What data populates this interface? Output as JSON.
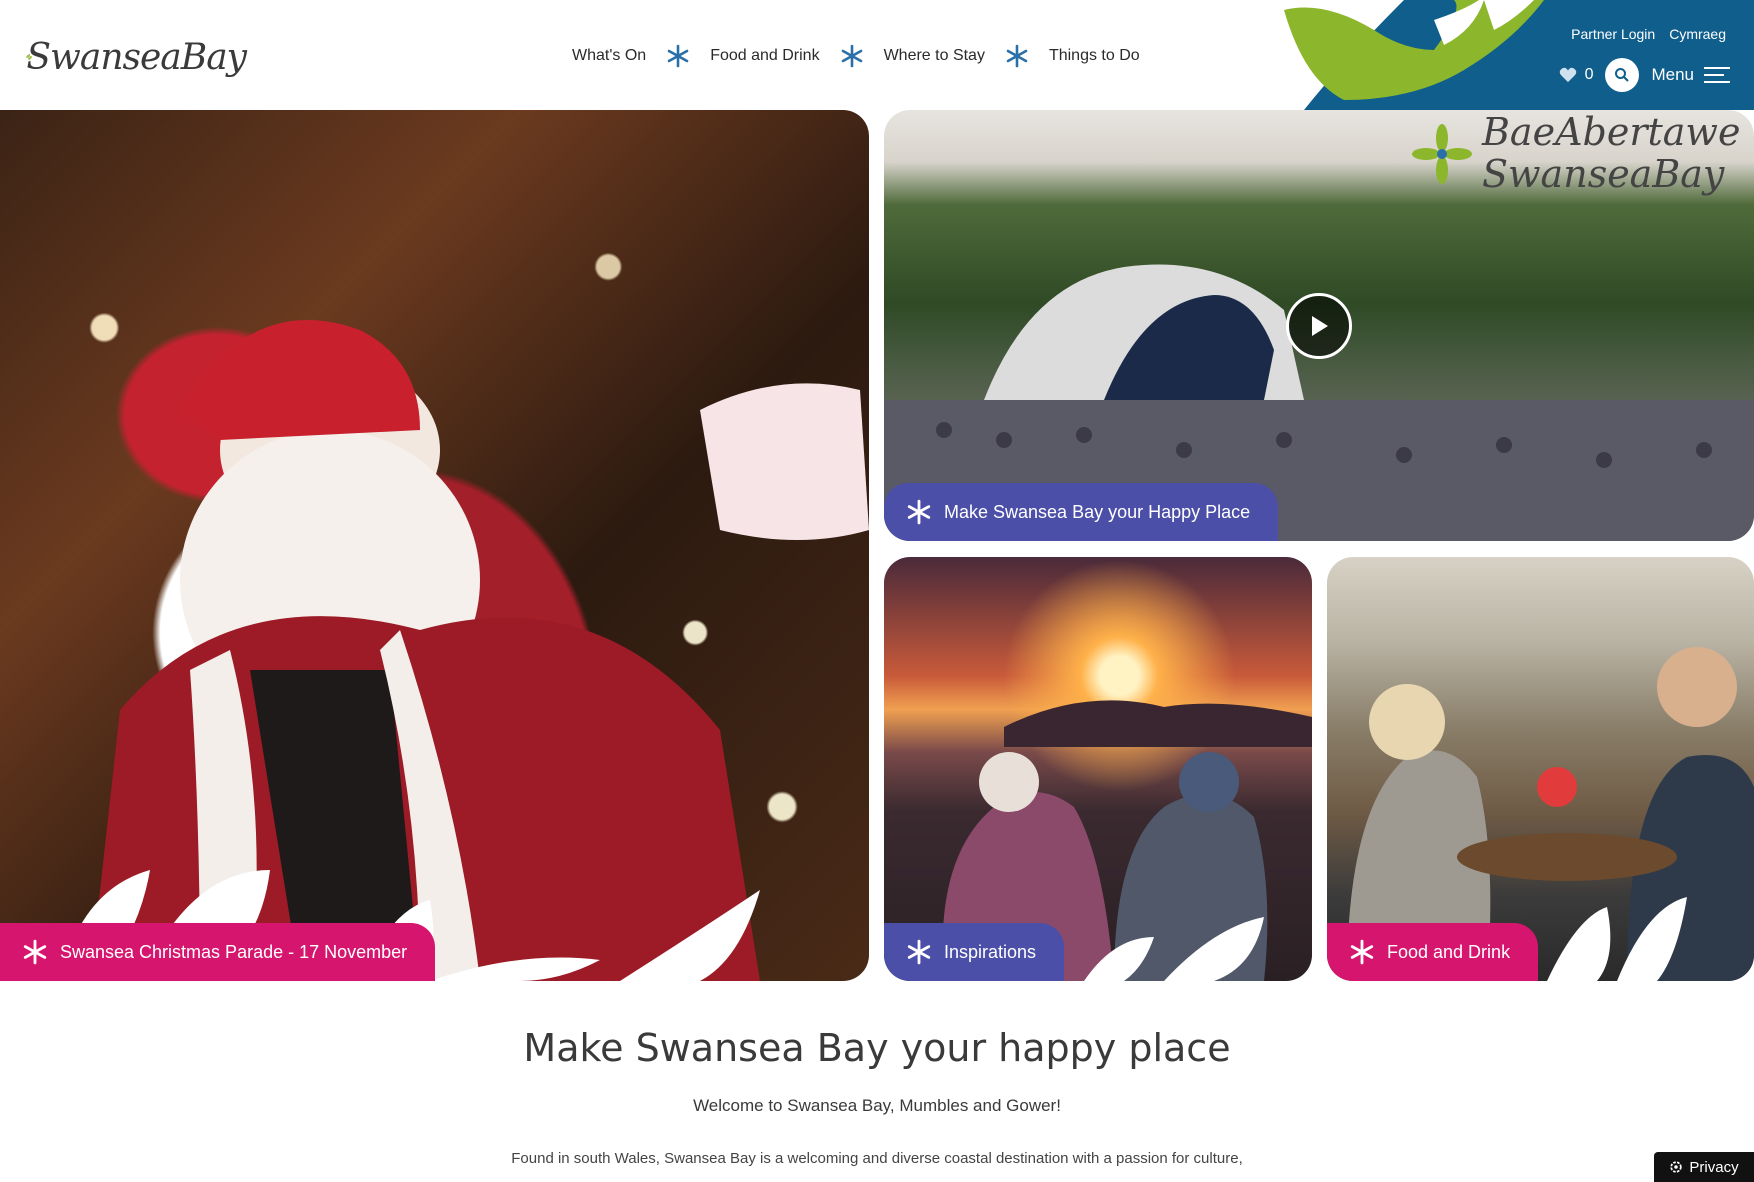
{
  "header": {
    "logo_text": "SwanseaBay",
    "nav": [
      {
        "label": "What's On"
      },
      {
        "label": "Food and Drink"
      },
      {
        "label": "Where to Stay"
      },
      {
        "label": "Things to Do"
      }
    ],
    "utility": {
      "partner_login": "Partner Login",
      "language": "Cymraeg"
    },
    "favourites_count": "0",
    "menu_label": "Menu",
    "colors": {
      "blue": "#0f5e8c",
      "green": "#8cb72d"
    }
  },
  "hero": {
    "big": {
      "label": "Swansea Christmas Parade - 17 November"
    },
    "concert": {
      "label": "Make Swansea Bay your Happy Place",
      "logo_welsh": "BaeAbertawe",
      "logo_english": "SwanseaBay"
    },
    "sunset": {
      "label": "Inspirations"
    },
    "food": {
      "label": "Food and Drink"
    },
    "colors": {
      "pink": "#d6166e",
      "purple": "#4b4fa8"
    }
  },
  "intro": {
    "heading": "Make Swansea Bay your happy place",
    "welcome": "Welcome to Swansea Bay, Mumbles and Gower!",
    "body": "Found in south Wales, Swansea Bay is a welcoming and diverse coastal destination with a passion for culture,"
  },
  "privacy": {
    "label": "Privacy"
  }
}
